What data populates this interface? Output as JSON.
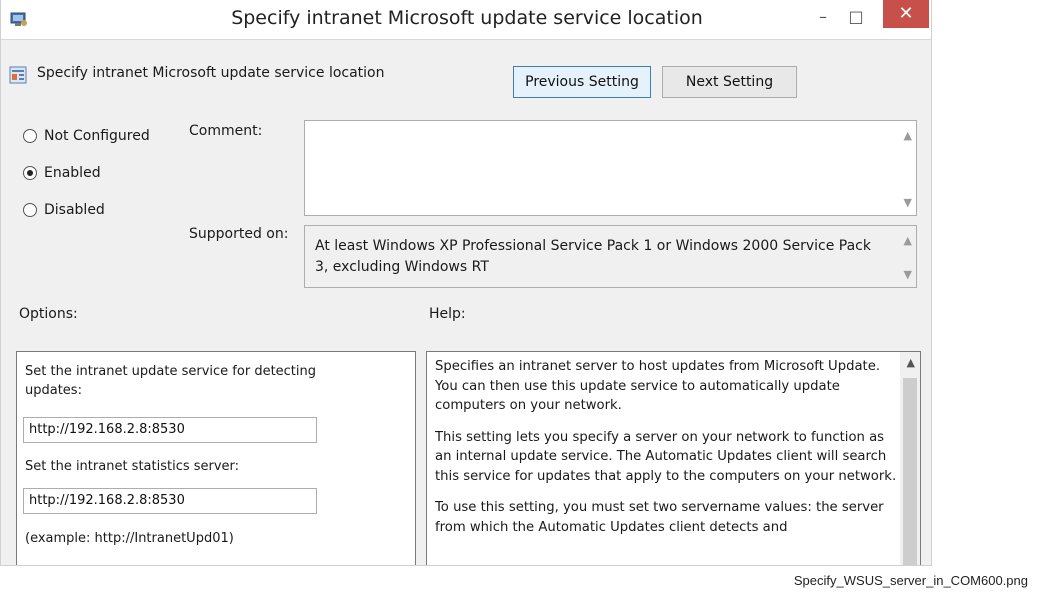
{
  "window": {
    "title": "Specify intranet Microsoft update service location",
    "minimize_glyph": "–",
    "maximize_glyph": "□",
    "close_glyph": "✕",
    "close_color": "#c7504a"
  },
  "header": {
    "setting_name": "Specify intranet Microsoft update service location",
    "previous_label": "Previous Setting",
    "next_label": "Next Setting"
  },
  "state": {
    "options": [
      {
        "label": "Not Configured",
        "selected": false
      },
      {
        "label": "Enabled",
        "selected": true
      },
      {
        "label": "Disabled",
        "selected": false
      }
    ]
  },
  "comment": {
    "label": "Comment:",
    "value": ""
  },
  "supported": {
    "label": "Supported on:",
    "text": "At least Windows XP Professional Service Pack 1 or Windows 2000 Service Pack 3, excluding Windows RT"
  },
  "options_panel": {
    "heading": "Options:",
    "detect_label": "Set the intranet update service for detecting updates:",
    "detect_value": "http://192.168.2.8:8530",
    "stats_label": "Set the intranet statistics server:",
    "stats_value": "http://192.168.2.8:8530",
    "example": "(example: http://IntranetUpd01)"
  },
  "help_panel": {
    "heading": "Help:",
    "paragraphs": [
      "Specifies an intranet server to host updates from Microsoft Update. You can then use this update service to automatically update computers on your network.",
      "This setting lets you specify a server on your network to function as an internal update service. The Automatic Updates client will search this service for updates that apply to the computers on your network.",
      "To use this setting, you must set two servername values: the server from which the Automatic Updates client detects and"
    ]
  },
  "caption": "Specify_WSUS_server_in_COM600.png"
}
